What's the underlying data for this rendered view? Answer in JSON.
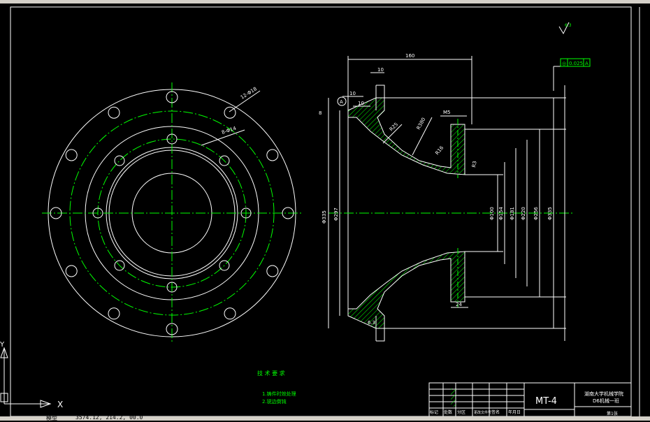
{
  "drawing": {
    "title_block": {
      "drawing_number": "MT-4",
      "school": "湖南大学机械学院",
      "subtitle": "D6机械一班",
      "sheet": "第1张",
      "row_labels": [
        "标记",
        "处数",
        "分区",
        "更改文件号",
        "签名",
        "年月日"
      ]
    },
    "tech_requirements": {
      "heading": "技 术 要 求",
      "items": [
        "1.铸件时效处理",
        "2.锐边倒钝"
      ]
    },
    "front_view": {
      "outer_holes_label": "12-Φ18",
      "inner_holes_label": "8-Φ14"
    },
    "section_view": {
      "dims": {
        "total_length": "160",
        "flange_thickness": "10",
        "step_a": "10",
        "step_b": "10",
        "offset": "8",
        "r25": "R25",
        "r380": "R380",
        "r16": "R16",
        "m5": "M5",
        "hub_width": "24",
        "small_r": "R3",
        "d335": "Φ335",
        "d297": "Φ297",
        "d100": "Φ100",
        "d154": "Φ154",
        "d181": "Φ181",
        "d220": "Φ220",
        "d256": "Φ256",
        "d335b": "Φ335",
        "roughness": "6.3",
        "datum": "A",
        "tolerance_symbol": "◎",
        "tolerance_value": "0.025",
        "tolerance_datum": "A"
      },
      "general_roughness": "6.3"
    },
    "ucs": {
      "x_label": "X",
      "y_label": "Y"
    }
  },
  "status_bar": {
    "model_tab": "模型",
    "coords": "3574.12, 214.2, 00.0"
  }
}
